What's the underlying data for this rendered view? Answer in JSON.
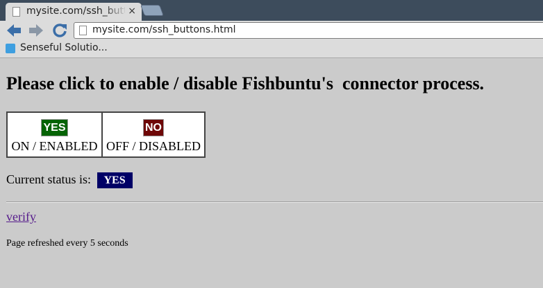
{
  "browser": {
    "tab": {
      "title": "mysite.com/ssh_buttons.html",
      "close": "×"
    },
    "nav": {
      "back": "🡄",
      "forward": "🡆",
      "reload": "⟳"
    },
    "omnibox": {
      "url": "mysite.com/ssh_buttons.html"
    },
    "bookmarks": [
      {
        "label": "Senseful Solutio...",
        "icon": "globe-icon"
      }
    ]
  },
  "page": {
    "heading": "Please click to enable / disable Fishbuntu's  connector process.",
    "buttons": [
      {
        "badge": "YES",
        "label": "ON / ENABLED",
        "color": "#056305"
      },
      {
        "badge": "NO",
        "label": "OFF / DISABLED",
        "color": "#6e0707"
      }
    ],
    "status": {
      "label": "Current status is:",
      "value": "YES",
      "color": "#000066"
    },
    "verify_link": "verify",
    "refresh_note": "Page refreshed every 5 seconds"
  }
}
